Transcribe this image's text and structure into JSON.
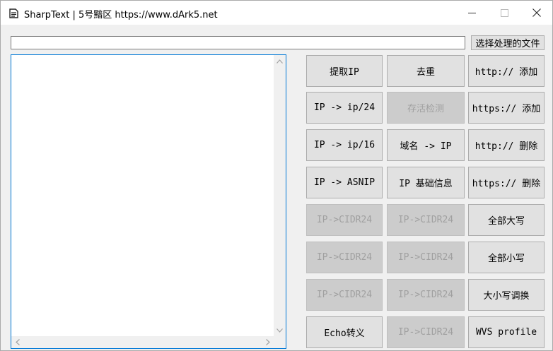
{
  "window": {
    "title": "SharpText | 5号黯区 https://www.dArk5.net"
  },
  "file_picker": {
    "path_value": "",
    "button_label": "选择处理的文件"
  },
  "editor": {
    "content": ""
  },
  "buttons": {
    "col1": [
      {
        "id": "extract-ip",
        "label": "提取IP",
        "enabled": true
      },
      {
        "id": "ip-to-c24",
        "label": "IP -> ip/24",
        "enabled": true
      },
      {
        "id": "ip-to-b16",
        "label": "IP -> ip/16",
        "enabled": true
      },
      {
        "id": "ip-to-asnip",
        "label": "IP -> ASNIP",
        "enabled": true
      },
      {
        "id": "ip-cidr24-1",
        "label": "IP->CIDR24",
        "enabled": false
      },
      {
        "id": "ip-cidr24-2",
        "label": "IP->CIDR24",
        "enabled": false
      },
      {
        "id": "ip-cidr24-3",
        "label": "IP->CIDR24",
        "enabled": false
      },
      {
        "id": "echo-escape",
        "label": "Echo转义",
        "enabled": true
      }
    ],
    "col2": [
      {
        "id": "dedupe",
        "label": "去重",
        "enabled": true
      },
      {
        "id": "alive-check",
        "label": "存活检测",
        "enabled": false
      },
      {
        "id": "domain-to-ip",
        "label": "域名 -> IP",
        "enabled": true
      },
      {
        "id": "ip-basic-info",
        "label": "IP 基础信息",
        "enabled": true
      },
      {
        "id": "ip-cidr24-4",
        "label": "IP->CIDR24",
        "enabled": false
      },
      {
        "id": "ip-cidr24-5",
        "label": "IP->CIDR24",
        "enabled": false
      },
      {
        "id": "ip-cidr24-6",
        "label": "IP->CIDR24",
        "enabled": false
      },
      {
        "id": "ip-cidr24-7",
        "label": "IP->CIDR24",
        "enabled": false
      }
    ],
    "col3": [
      {
        "id": "add-http",
        "label": "http:// 添加",
        "enabled": true
      },
      {
        "id": "add-https",
        "label": "https:// 添加",
        "enabled": true
      },
      {
        "id": "remove-http",
        "label": "http:// 删除",
        "enabled": true
      },
      {
        "id": "remove-https",
        "label": "https:// 删除",
        "enabled": true
      },
      {
        "id": "all-upper",
        "label": "全部大写",
        "enabled": true
      },
      {
        "id": "all-lower",
        "label": "全部小写",
        "enabled": true
      },
      {
        "id": "swap-case",
        "label": "大小写调换",
        "enabled": true
      },
      {
        "id": "wvs-profile",
        "label": "WVS profile",
        "enabled": true
      }
    ]
  },
  "icons": {
    "app": "document-icon",
    "minimize": "minimize-icon",
    "maximize": "maximize-icon",
    "close": "close-icon"
  }
}
